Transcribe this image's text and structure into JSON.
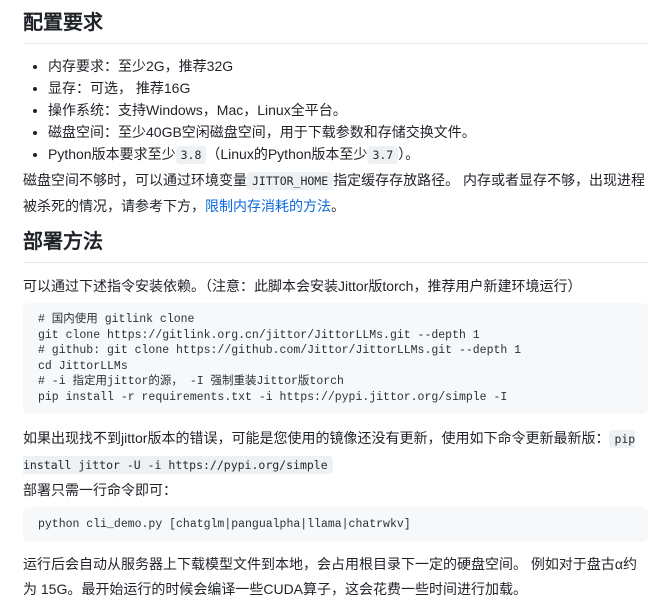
{
  "colors": {
    "text": "#1f2328",
    "link": "#0969da",
    "heading_border": "#e4e7eb",
    "code_block_bg": "#f6f8fa",
    "inline_code_bg": "#eef1f3"
  },
  "config": {
    "heading": "配置要求",
    "bullets": {
      "memory": "内存要求：至少2G，推荐32G",
      "vram": "显存：可选， 推荐16G",
      "os": "操作系统：支持Windows，Mac，Linux全平台。",
      "disk": "磁盘空间：至少40GB空闲磁盘空间，用于下载参数和存储交换文件。",
      "python_pre": "Python版本要求至少",
      "python_code_1": "3.8",
      "python_mid": "（Linux的Python版本至少",
      "python_code_2": "3.7",
      "python_post": "）。"
    },
    "note": {
      "pre": "磁盘空间不够时，可以通过环境变量",
      "env_code": "JITTOR_HOME",
      "mid": "指定缓存存放路径。 内存或者显存不够，出现进程被杀死的情况，请参考下方，",
      "link": "限制内存消耗的方法",
      "post": "。"
    }
  },
  "deploy": {
    "heading": "部署方法",
    "intro": "可以通过下述指令安装依赖。（注意：此脚本会安装Jittor版torch，推荐用户新建环境运行）",
    "install_code": [
      "# 国内使用 gitlink clone",
      "git clone https://gitlink.org.cn/jittor/JittorLLMs.git --depth 1",
      "# github: git clone https://github.com/Jittor/JittorLLMs.git --depth 1",
      "cd JittorLLMs",
      "# -i 指定用jittor的源， -I 强制重装Jittor版torch",
      "pip install -r requirements.txt -i https://pypi.jittor.org/simple -I"
    ],
    "mirror_pre": "如果出现找不到jittor版本的错误，可能是您使用的镜像还没有更新，使用如下命令更新最新版：",
    "mirror_code": "pip install jittor -U -i https://pypi.org/simple",
    "oneline": "部署只需一行命令即可：",
    "run_code": "python cli_demo.py [chatglm|pangualpha|llama|chatrwkv]",
    "outro": "运行后会自动从服务器上下载模型文件到本地，会占用根目录下一定的硬盘空间。 例如对于盘古α约为 15G。最开始运行的时候会编译一些CUDA算子，这会花费一些时间进行加载。"
  }
}
